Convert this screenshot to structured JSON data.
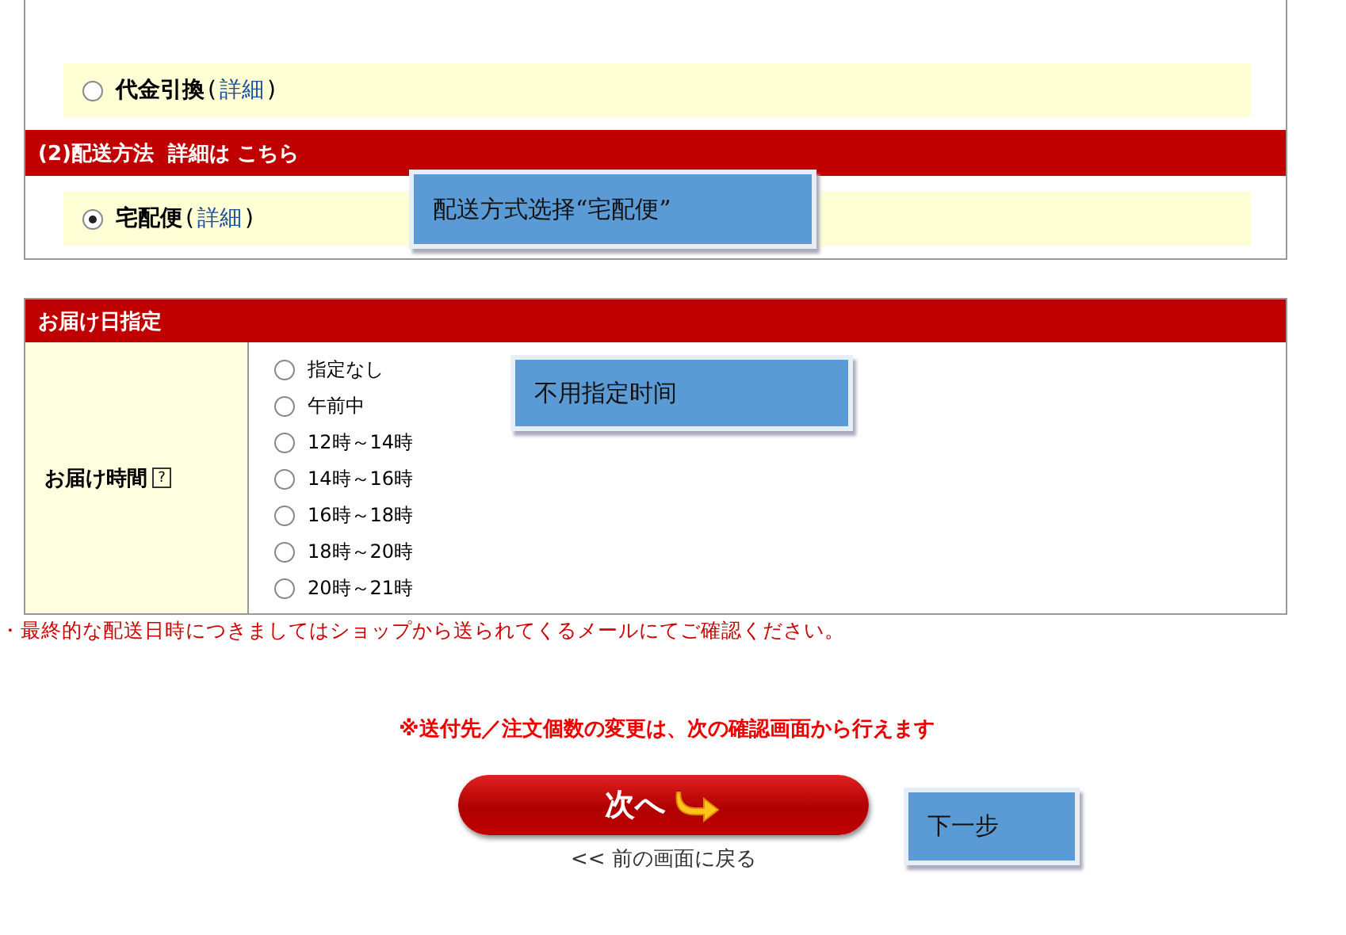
{
  "payment": {
    "options": [
      {
        "label": "代金引換",
        "open": "(",
        "link": "詳細",
        "close": ")",
        "selected": false
      }
    ]
  },
  "shipping": {
    "header": "(2)配送方法  詳細は こちら",
    "options": [
      {
        "label": "宅配便",
        "open": "(",
        "link": "詳細",
        "close": ")",
        "selected": true
      }
    ]
  },
  "delivery": {
    "header": "お届け日指定",
    "field_label": "お届け時間",
    "help": "?",
    "options": [
      {
        "label": "指定なし",
        "selected": false
      },
      {
        "label": "午前中",
        "selected": false
      },
      {
        "label": "12時～14時",
        "selected": false
      },
      {
        "label": "14時～16時",
        "selected": false
      },
      {
        "label": "16時～18時",
        "selected": false
      },
      {
        "label": "18時～20時",
        "selected": false
      },
      {
        "label": "20時～21時",
        "selected": false
      }
    ]
  },
  "note": "・最終的な配送日時につきましてはショップから送られてくるメールにてご確認ください。",
  "change_notice": "※送付先／注文個数の変更は、次の確認画面から行えます",
  "next_button": "次へ",
  "back_link": "<< 前の画面に戻る",
  "callouts": [
    {
      "text": "配送方式选择“宅配便”"
    },
    {
      "text": "不用指定时间"
    },
    {
      "text": "下一步"
    }
  ]
}
